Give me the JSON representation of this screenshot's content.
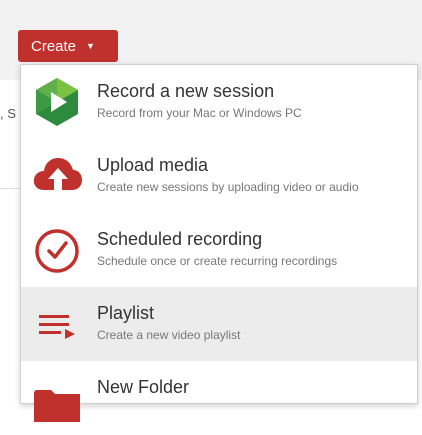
{
  "create_button": {
    "label": "Create",
    "caret": "▼",
    "color": "#c0302c"
  },
  "background_fragment": ", S",
  "menu": {
    "items": [
      {
        "title": "Record a new session",
        "subtitle": "Record from your Mac or Windows PC",
        "icon": "panopto-logo-icon",
        "highlighted": false
      },
      {
        "title": "Upload media",
        "subtitle": "Create new sessions by uploading video or audio",
        "icon": "cloud-upload-icon",
        "highlighted": false
      },
      {
        "title": "Scheduled recording",
        "subtitle": "Schedule once or create recurring recordings",
        "icon": "clock-icon",
        "highlighted": false
      },
      {
        "title": "Playlist",
        "subtitle": "Create a new video playlist",
        "icon": "playlist-icon",
        "highlighted": true
      },
      {
        "title": "New Folder",
        "subtitle": "",
        "icon": "folder-icon",
        "highlighted": false
      }
    ]
  },
  "colors": {
    "accent_red": "#c0302c",
    "logo_green_light": "#7cc242",
    "logo_green_dark": "#2e8b3d",
    "highlight_bg": "#ececec"
  }
}
